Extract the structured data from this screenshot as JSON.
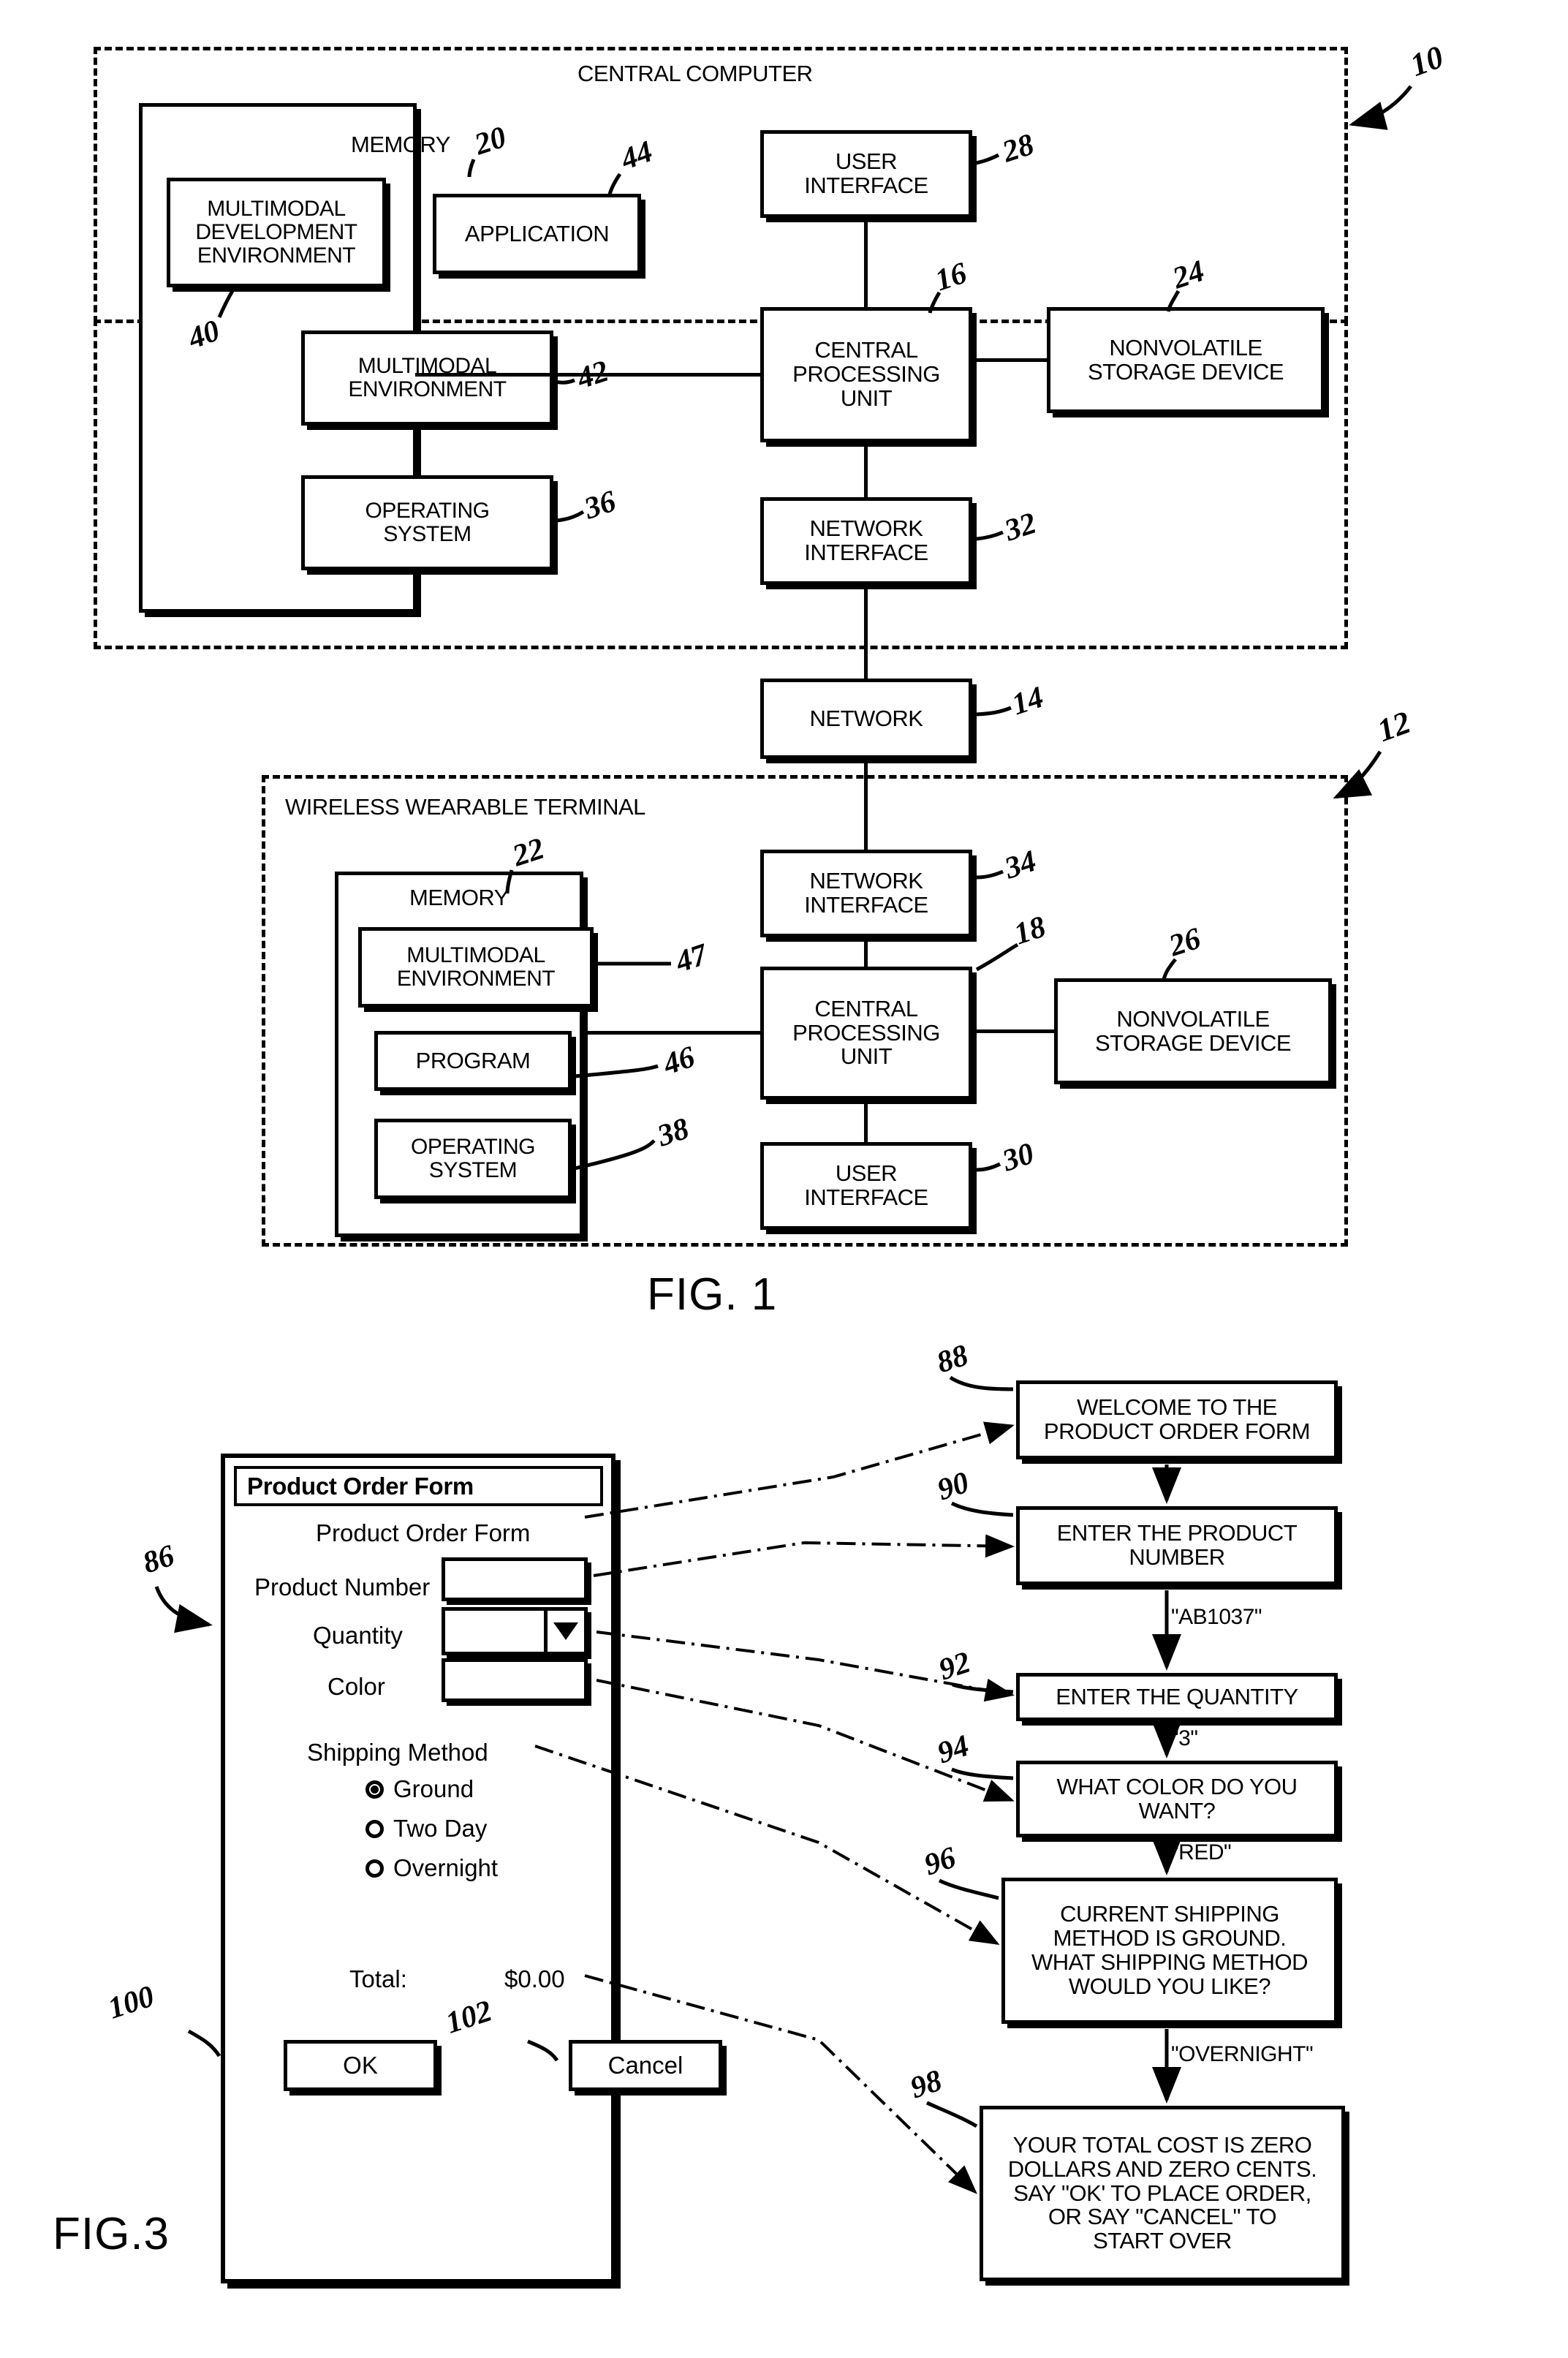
{
  "figure1": {
    "outer_label": "CENTRAL COMPUTER",
    "outer_ref": "10",
    "memory": {
      "label": "MEMORY",
      "ref": "20",
      "blocks": [
        {
          "label": "MULTIMODAL\nDEVELOPMENT\nENVIRONMENT",
          "ref": "40"
        },
        {
          "label": "APPLICATION",
          "ref": "44"
        },
        {
          "label": "MULTIMODAL\nENVIRONMENT",
          "ref": "42"
        },
        {
          "label": "OPERATING\nSYSTEM",
          "ref": "36"
        }
      ]
    },
    "blocks": [
      {
        "label": "USER\nINTERFACE",
        "ref": "28"
      },
      {
        "label": "CENTRAL\nPROCESSING\nUNIT",
        "ref": "16"
      },
      {
        "label": "NONVOLATILE\nSTORAGE DEVICE",
        "ref": "24"
      },
      {
        "label": "NETWORK\nINTERFACE",
        "ref": "32"
      }
    ],
    "network": {
      "label": "NETWORK",
      "ref": "14"
    },
    "terminal": {
      "outer_label": "WIRELESS WEARABLE TERMINAL",
      "outer_ref": "12",
      "memory": {
        "label": "MEMORY",
        "ref": "22",
        "blocks": [
          {
            "label": "MULTIMODAL\nENVIRONMENT",
            "ref": "47"
          },
          {
            "label": "PROGRAM",
            "ref": "46"
          },
          {
            "label": "OPERATING\nSYSTEM",
            "ref": "38"
          }
        ]
      },
      "blocks": [
        {
          "label": "NETWORK\nINTERFACE",
          "ref": "34"
        },
        {
          "label": "CENTRAL\nPROCESSING\nUNIT",
          "ref": "18"
        },
        {
          "label": "NONVOLATILE\nSTORAGE DEVICE",
          "ref": "26"
        },
        {
          "label": "USER\nINTERFACE",
          "ref": "30"
        }
      ]
    },
    "caption": "FIG. 1"
  },
  "figure3": {
    "caption": "FIG.3",
    "dialog_ref": "86",
    "titlebar": "Product Order Form",
    "heading": "Product Order Form",
    "fields": [
      {
        "label": "Product Number",
        "value": "",
        "type": "text"
      },
      {
        "label": "Quantity",
        "value": "",
        "type": "combo"
      },
      {
        "label": "Color",
        "value": "",
        "type": "text"
      }
    ],
    "shipping": {
      "label": "Shipping Method",
      "options": [
        "Ground",
        "Two Day",
        "Overnight"
      ],
      "selected": "Ground"
    },
    "total_label": "Total:",
    "total_value": "$0.00",
    "buttons": [
      {
        "label": "OK",
        "ref": "100"
      },
      {
        "label": "Cancel",
        "ref": "102"
      }
    ],
    "prompts": [
      {
        "ref": "88",
        "text": "WELCOME TO THE\nPRODUCT ORDER FORM"
      },
      {
        "ref": "90",
        "text": "ENTER THE PRODUCT\nNUMBER"
      },
      {
        "ref": "92",
        "text": "ENTER THE QUANTITY"
      },
      {
        "ref": "94",
        "text": "WHAT COLOR DO YOU\nWANT?"
      },
      {
        "ref": "96",
        "text": "CURRENT SHIPPING\nMETHOD IS GROUND.\nWHAT SHIPPING METHOD\nWOULD YOU LIKE?"
      },
      {
        "ref": "98",
        "text": "YOUR TOTAL COST IS ZERO\nDOLLARS AND ZERO CENTS.\nSAY \"OK' TO PLACE ORDER,\nOR SAY \"CANCEL\" TO\nSTART OVER"
      }
    ],
    "utterances": [
      "\"AB1037\"",
      "\"3\"",
      "\"RED\"",
      "\"OVERNIGHT\""
    ]
  }
}
